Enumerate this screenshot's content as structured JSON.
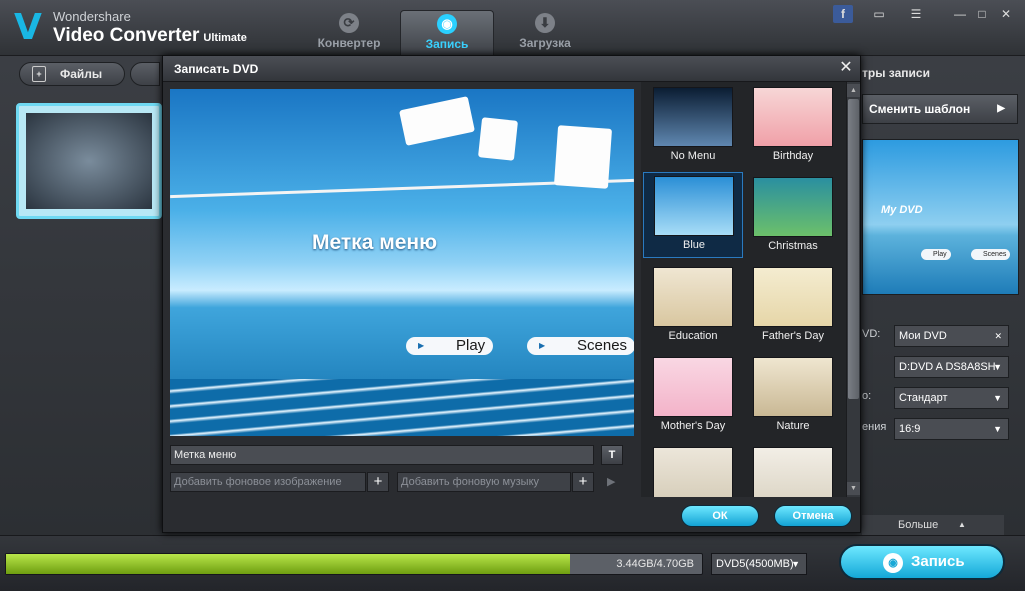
{
  "app": {
    "logo_letter": "V",
    "brand_top": "Wondershare",
    "brand_main": "Video Converter",
    "brand_edition": "Ultimate"
  },
  "tabs": [
    {
      "label": "Конвертер",
      "icon": "refresh-icon"
    },
    {
      "label": "Запись",
      "icon": "disc-icon",
      "active": true
    },
    {
      "label": "Загрузка",
      "icon": "download-icon"
    }
  ],
  "window_controls": {
    "facebook": "f",
    "minimize": "—",
    "maximize": "□",
    "close": "✕"
  },
  "sidebar": {
    "files_button": "Файлы"
  },
  "right_panel": {
    "header": "тры записи",
    "change_template": "Сменить шаблон",
    "preview_title": "My DVD",
    "preview_play": "Play",
    "preview_scenes": "Scenes",
    "fields": [
      {
        "label": "VD:",
        "value": "Мои DVD",
        "control": "clear"
      },
      {
        "label": "",
        "value": "D:DVD A  DS8A8SH",
        "control": "dropdown"
      },
      {
        "label": "о:",
        "value": "Стандарт",
        "control": "dropdown"
      },
      {
        "label": "ения",
        "value": "16:9",
        "control": "dropdown"
      }
    ],
    "more_label": "Больше"
  },
  "bottom": {
    "progress_fraction": 0.81,
    "progress_text": "3.44GB/4.70GB",
    "dvd_type": "DVD5(4500MB)",
    "burn_button": "Запись"
  },
  "dialog": {
    "title": "Записать DVD",
    "preview": {
      "title": "Метка меню",
      "play": "Play",
      "scenes": "Scenes"
    },
    "menu_label_value": "Метка меню",
    "text_button": "T",
    "bg_image_placeholder": "Добавить фоновое изображение",
    "bg_music_placeholder": "Добавить фоновую музыку",
    "ok_button": "ОК",
    "cancel_button": "Отмена",
    "templates": [
      {
        "name": "No Menu",
        "selected": false,
        "colors": [
          "#0b1d33",
          "#5f87b0"
        ]
      },
      {
        "name": "Birthday",
        "selected": false,
        "colors": [
          "#f7d6d6",
          "#f0a0a8"
        ]
      },
      {
        "name": "Blue",
        "selected": true,
        "colors": [
          "#2b8fd6",
          "#a8ddf7"
        ]
      },
      {
        "name": "Christmas",
        "selected": false,
        "colors": [
          "#2a8fa0",
          "#6cc06a"
        ]
      },
      {
        "name": "Education",
        "selected": false,
        "colors": [
          "#efe6d2",
          "#d9c7a0"
        ]
      },
      {
        "name": "Father's Day",
        "selected": false,
        "colors": [
          "#f4ecd0",
          "#e6d6a8"
        ]
      },
      {
        "name": "Mother's Day",
        "selected": false,
        "colors": [
          "#f9d7e3",
          "#f3b3c9"
        ]
      },
      {
        "name": "Nature",
        "selected": false,
        "colors": [
          "#efe6d0",
          "#c9b894"
        ]
      },
      {
        "name": "",
        "selected": false,
        "colors": [
          "#ece6da",
          "#d4cbb6"
        ]
      },
      {
        "name": "",
        "selected": false,
        "colors": [
          "#f2eee6",
          "#dad3c2"
        ]
      }
    ]
  }
}
